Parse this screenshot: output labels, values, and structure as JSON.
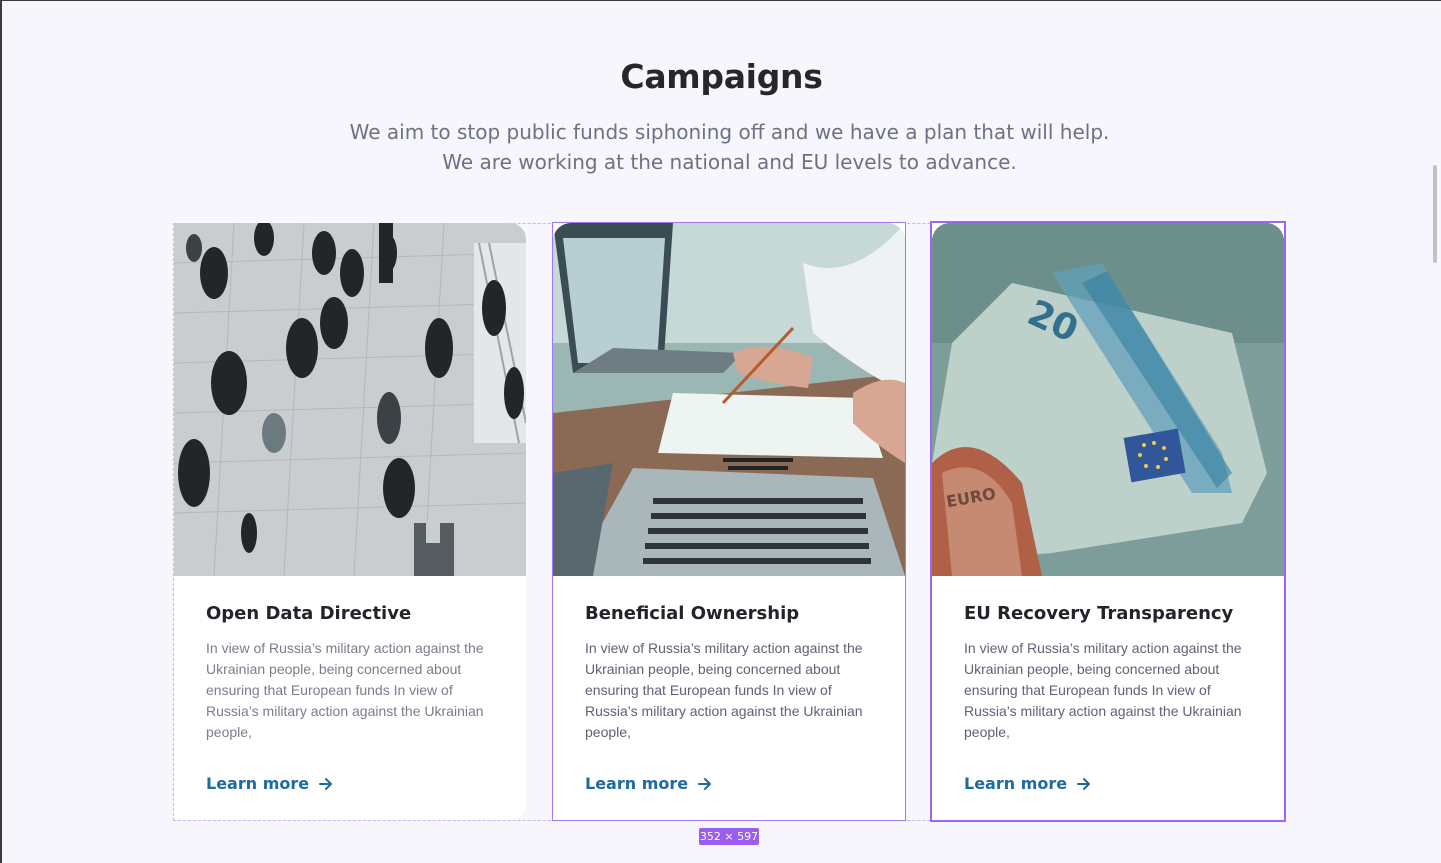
{
  "section": {
    "title": "Campaigns",
    "subtitle": "We aim to stop public funds siphoning off and we have a plan that will help. We are working at the national and EU levels to advance."
  },
  "cards": [
    {
      "title": "Open Data Directive",
      "text": "In view of Russia’s military action against the Ukrainian people, being concerned about ensuring that European funds In view of Russia’s military action against the Ukrainian people,",
      "link": "Learn more"
    },
    {
      "title": "Beneficial Ownership",
      "text": "In view of Russia’s military action against the Ukrainian people, being concerned about ensuring that European funds In view of Russia’s military action against the Ukrainian people,",
      "link": "Learn more"
    },
    {
      "title": "EU Recovery Transparency",
      "text": "In view of Russia’s military action against the Ukrainian people, being concerned about ensuring that European funds In view of Russia’s military action against the Ukrainian people,",
      "link": "Learn more"
    }
  ],
  "overlay": {
    "size_badge": "352 × 597"
  },
  "colors": {
    "link": "#1e6b9e",
    "selection": "#9b5cf0",
    "background": "#f7f6fc"
  },
  "icons": [
    "arrow-right-icon"
  ]
}
